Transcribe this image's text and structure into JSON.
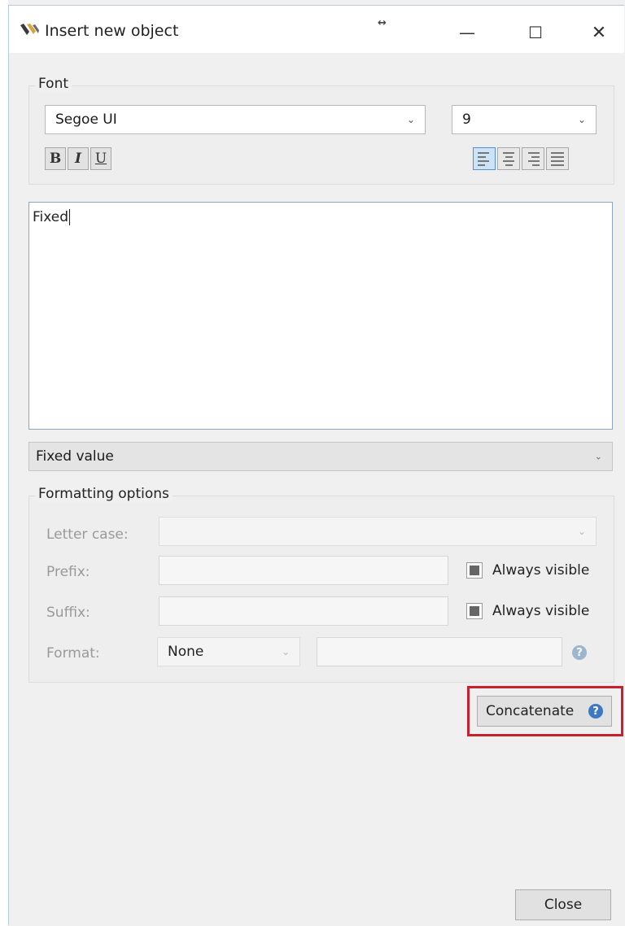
{
  "window": {
    "title": "Insert new object",
    "drag_glyph": "↔",
    "controls": {
      "minimize": "—",
      "maximize": "☐",
      "close": "✕"
    }
  },
  "font": {
    "group_label": "Font",
    "family": "Segoe UI",
    "size": "9",
    "styles": {
      "bold": "B",
      "italic": "I",
      "underline": "U"
    },
    "alignment_selected": "left"
  },
  "editor": {
    "text": "Fixed"
  },
  "value_type": {
    "selected": "Fixed value"
  },
  "formatting": {
    "group_label": "Formatting options",
    "letter_case_label": "Letter case:",
    "letter_case_value": "",
    "prefix_label": "Prefix:",
    "prefix_value": "",
    "prefix_always_visible_label": "Always visible",
    "suffix_label": "Suffix:",
    "suffix_value": "",
    "suffix_always_visible_label": "Always visible",
    "format_label": "Format:",
    "format_selected": "None",
    "format_value": ""
  },
  "actions": {
    "concatenate_label": "Concatenate",
    "close_label": "Close"
  },
  "colors": {
    "highlight_border": "#c8202f",
    "help_icon": "#3c78c4",
    "active_align": "#cde3f7"
  }
}
